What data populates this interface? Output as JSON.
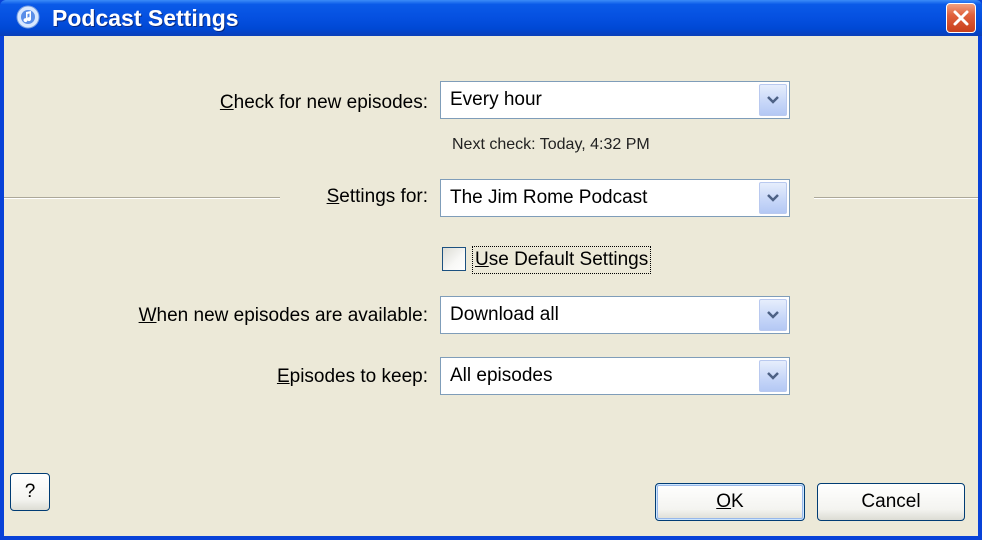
{
  "window": {
    "title": "Podcast Settings",
    "icon": "itunes-app-icon",
    "close_icon": "close-icon"
  },
  "check": {
    "label_key": "C",
    "label_rest": "heck for new episodes:",
    "value": "Every hour",
    "next_check": "Next check: Today, 4:32 PM"
  },
  "settings_for": {
    "label_key": "S",
    "label_rest": "ettings for:",
    "value": "The Jim Rome Podcast"
  },
  "use_default": {
    "label_key": "U",
    "label_rest": "se Default Settings",
    "checked": false
  },
  "when_new": {
    "label_key": "W",
    "label_rest": "hen new episodes are available:",
    "value": "Download all"
  },
  "episodes_keep": {
    "label_key": "E",
    "label_rest": "pisodes to keep:",
    "value": "All episodes"
  },
  "buttons": {
    "help": "?",
    "ok_key": "O",
    "ok_rest": "K",
    "cancel": "Cancel"
  },
  "colors": {
    "titlebar": "#0550e0",
    "client_bg": "#ece9d8",
    "field_border": "#7f9db9",
    "close_button": "#e0603c"
  }
}
